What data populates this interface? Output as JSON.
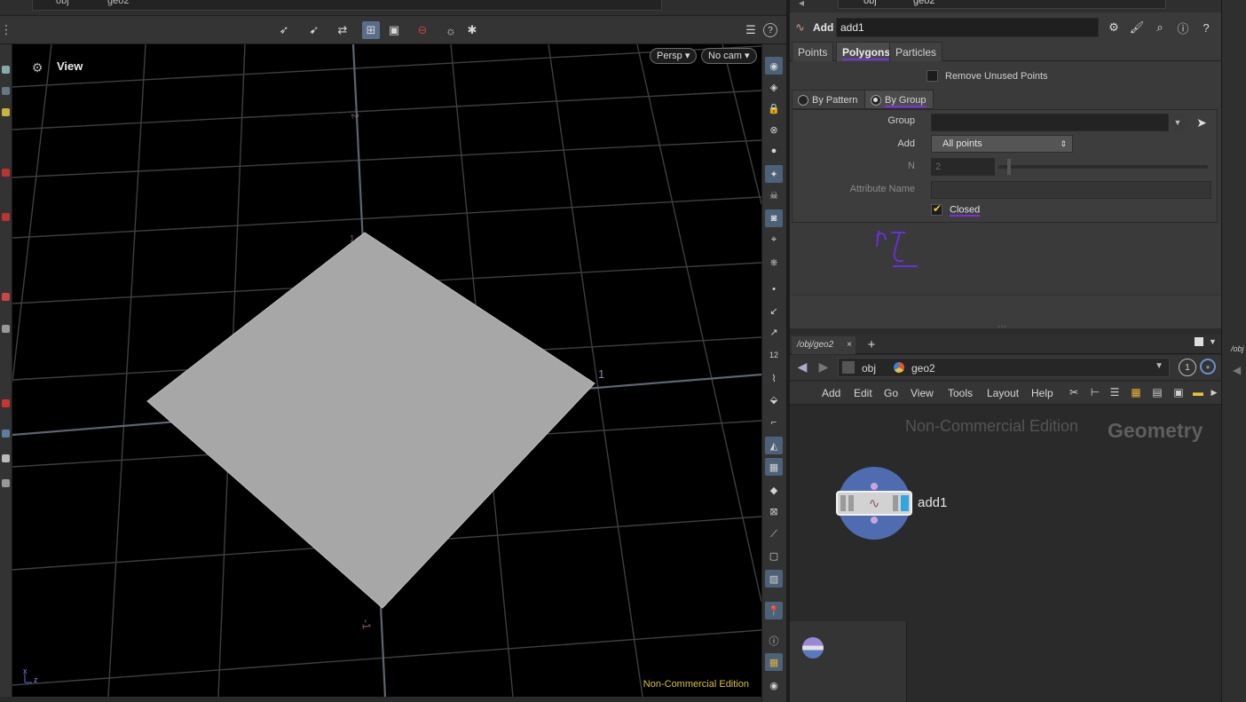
{
  "viewport": {
    "path": [
      "obj",
      "geo2"
    ],
    "title": "View",
    "persp_label": "Persp",
    "cam_label": "No cam",
    "watermark": "Non-Commercial Edition",
    "axis_labels": {
      "x": "x",
      "z": "z"
    },
    "grid_labels": [
      "2",
      "1",
      "1",
      "-1"
    ]
  },
  "params": {
    "path": [
      "obj",
      "geo2"
    ],
    "node_type": "Add",
    "node_name": "add1",
    "tabs": [
      {
        "label": "Points",
        "active": false
      },
      {
        "label": "Polygons",
        "active": true
      },
      {
        "label": "Particles",
        "active": false
      }
    ],
    "remove_unused_label": "Remove Unused Points",
    "mode_tabs": [
      {
        "label": "By Pattern",
        "active": false
      },
      {
        "label": "By Group",
        "active": true
      }
    ],
    "group_label": "Group",
    "group_value": "",
    "add_label": "Add",
    "add_value": "All points",
    "n_label": "N",
    "n_value": "2",
    "attr_label": "Attribute Name",
    "attr_value": "",
    "closed_label": "Closed",
    "closed_checked": true
  },
  "network": {
    "tab_label": "/obj/geo2",
    "path": [
      "obj",
      "geo2"
    ],
    "menus": [
      "Add",
      "Edit",
      "Go",
      "View",
      "Tools",
      "Layout",
      "Help"
    ],
    "watermark": "Non-Commercial Edition",
    "context_label": "Geometry",
    "node_label": "add1",
    "far_right_label": "/obj"
  },
  "colors": {
    "accent_blue": "#4f6cb0",
    "underline_purple": "#7d2ee0",
    "watermark_yellow": "#d7c23a",
    "checkbox_check": "#f0c23a"
  }
}
